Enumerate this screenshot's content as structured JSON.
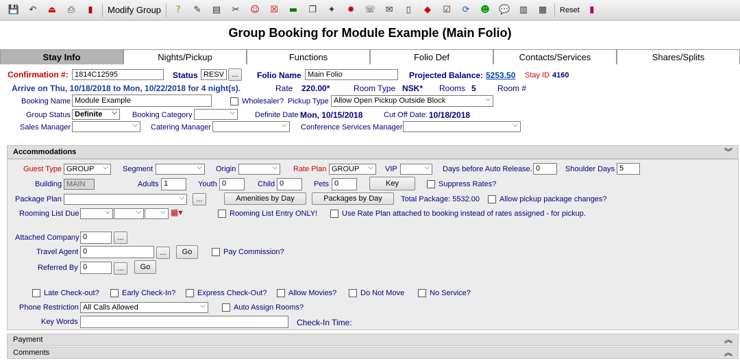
{
  "toolbar": {
    "modify_group_label": "Modify Group",
    "reset_label": "Reset",
    "icons": [
      "save-icon",
      "undo-icon",
      "exit-icon",
      "print-icon",
      "book-icon",
      "help-icon",
      "edit-icon",
      "notes-icon",
      "cut-icon",
      "people-icon",
      "cancel-icon",
      "cash-icon",
      "copy-icon",
      "wand-icon",
      "ttl-icon",
      "phone-icon",
      "mail-icon",
      "document-icon",
      "tag-icon",
      "checklist-icon",
      "refresh-icon",
      "smiley-icon",
      "chat-icon",
      "report-icon",
      "pages-icon",
      "books-icon"
    ]
  },
  "title": "Group Booking for Module Example (Main Folio)",
  "tabs": [
    "Stay Info",
    "Nights/Pickup",
    "Functions",
    "Folio Def",
    "Contacts/Services",
    "Shares/Splits"
  ],
  "header": {
    "confirmation_label": "Confirmation #:",
    "confirmation_value": "1814C12595",
    "status_label": "Status",
    "status_value": "RESV",
    "status_btn": "...",
    "folio_name_label": "Folio Name",
    "folio_name_value": "Main Folio",
    "projected_balance_label": "Projected Balance:",
    "projected_balance_value": "5253.50",
    "stay_id_label": "Stay ID",
    "stay_id_value": "4160",
    "arrive_text": "Arrive on Thu, 10/18/2018 to Mon, 10/22/2018 for 4 night(s).",
    "rate_label": "Rate",
    "rate_value": "220.00*",
    "room_type_label": "Room Type",
    "room_type_value": "NSK*",
    "rooms_label": "Rooms",
    "rooms_value": "5",
    "room_no_label": "Room #",
    "booking_name_label": "Booking Name",
    "booking_name_value": "Module Example",
    "wholesaler_label": "Wholesaler?",
    "pickup_type_label": "Pickup Type",
    "pickup_type_value": "Allow Open Pickup Outside Block",
    "group_status_label": "Group Status",
    "group_status_value": "Definite",
    "booking_category_label": "Booking Category",
    "booking_category_value": "",
    "definite_date_label": "Definite Date",
    "definite_date_value": "Mon, 10/15/2018",
    "cutoff_label": "Cut Off Date:",
    "cutoff_value": "10/18/2018",
    "sales_manager_label": "Sales Manager",
    "catering_manager_label": "Catering Manager",
    "conference_manager_label": "Conference Services Manager"
  },
  "accommodations": {
    "title": "Accommodations",
    "guest_type_label": "Guest Type",
    "guest_type_value": "GROUP",
    "segment_label": "Segment",
    "origin_label": "Origin",
    "rate_plan_label": "Rate Plan",
    "rate_plan_value": "GROUP",
    "vip_label": "VIP",
    "days_release_label": "Days before Auto Release.",
    "days_release_value": "0",
    "shoulder_days_label": "Shoulder Days",
    "shoulder_days_value": "5",
    "building_label": "Building",
    "building_value": "MAIN",
    "adults_label": "Adults",
    "adults_value": "1",
    "youth_label": "Youth",
    "youth_value": "0",
    "child_label": "Child",
    "child_value": "0",
    "pets_label": "Pets",
    "pets_value": "0",
    "key_btn": "Key",
    "suppress_rates_label": "Suppress Rates?",
    "package_plan_label": "Package Plan",
    "package_btn": "...",
    "amenities_btn": "Amenities by Day",
    "packages_btn": "Packages by Day",
    "total_package_text": "Total Package: 5532.00",
    "allow_pickup_label": "Allow pickup package changes?",
    "rooming_due_label": "Rooming List Due",
    "rooming_entry_label": "Rooming List Entry ONLY!",
    "use_rate_plan_label": "Use Rate Plan attached to booking instead of rates assigned - for pickup.",
    "attached_company_label": "Attached Company",
    "attached_company_value": "0",
    "travel_agent_label": "Travel Agent",
    "travel_agent_value": "0",
    "go_btn": "Go",
    "pay_commission_label": "Pay Commission?",
    "referred_by_label": "Referred By",
    "referred_by_value": "0",
    "late_checkout_label": "Late Check-out?",
    "early_checkin_label": "Early Check-In?",
    "express_checkout_label": "Express Check-Out?",
    "allow_movies_label": "Allow Movies?",
    "do_not_move_label": "Do Not Move",
    "no_service_label": "No Service?",
    "phone_restriction_label": "Phone Restriction",
    "phone_restriction_value": "All Calls Allowed",
    "auto_assign_label": "Auto Assign Rooms?",
    "key_words_label": "Key Words",
    "checkin_time_label": "Check-In Time:"
  },
  "sections": {
    "payment": "Payment",
    "comments": "Comments"
  },
  "icons": {
    "collapse": "double-chevron-down-icon",
    "expand": "double-chevron-up-icon"
  }
}
